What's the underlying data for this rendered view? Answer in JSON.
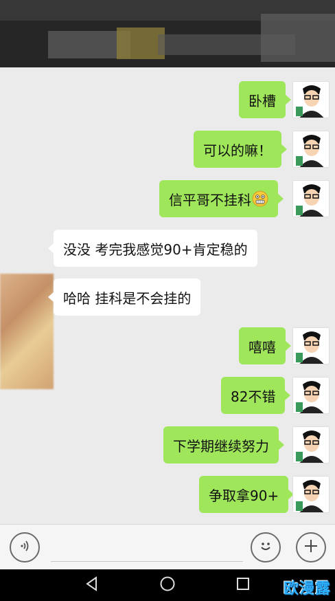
{
  "messages": [
    {
      "side": "me",
      "text": "卧槽"
    },
    {
      "side": "me",
      "text": "可以的嘛！"
    },
    {
      "side": "me",
      "text": "信平哥不挂科"
    },
    {
      "side": "them",
      "text": "没没 考完我感觉90+肯定稳的"
    },
    {
      "side": "them",
      "text": "哈哈 挂科是不会挂的"
    },
    {
      "side": "me",
      "text": "嘻嘻"
    },
    {
      "side": "me",
      "text": "82不错"
    },
    {
      "side": "me",
      "text": "下学期继续努力"
    },
    {
      "side": "me",
      "text": "争取拿90+"
    }
  ],
  "emoji_in_message_3": "grimacing-face-emoji",
  "colors": {
    "my_bubble": "#9fe65b",
    "their_bubble": "#ffffff",
    "chat_bg": "#ebebeb"
  },
  "input_bar": {
    "left_icon": "voice-icon",
    "emoji_icon": "smiley-icon",
    "plus_icon": "plus-icon"
  },
  "nav": {
    "back": "back-triangle-icon",
    "home": "home-circle-icon",
    "recents": "recents-square-icon"
  },
  "watermark": "欧漫露"
}
